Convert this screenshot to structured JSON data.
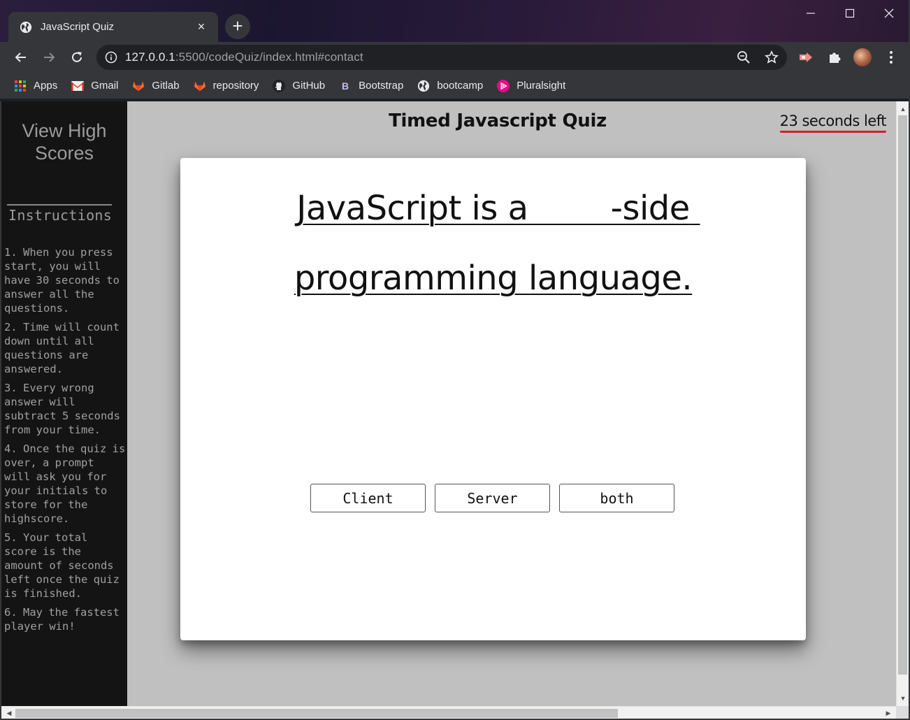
{
  "browser": {
    "tab_title": "JavaScript Quiz",
    "tab_close": "×",
    "new_tab": "+",
    "url_host": "127.0.0.1",
    "url_rest": ":5500/codeQuiz/index.html#contact",
    "bookmarks": [
      {
        "label": "Apps",
        "icon": "apps-grid-icon"
      },
      {
        "label": "Gmail",
        "icon": "gmail-icon"
      },
      {
        "label": "Gitlab",
        "icon": "gitlab-icon"
      },
      {
        "label": "repository",
        "icon": "gitlab-icon"
      },
      {
        "label": "GitHub",
        "icon": "github-icon"
      },
      {
        "label": "Bootstrap",
        "icon": "bootstrap-icon"
      },
      {
        "label": "bootcamp",
        "icon": "globe-icon"
      },
      {
        "label": "Pluralsight",
        "icon": "pluralsight-icon"
      }
    ]
  },
  "sidebar": {
    "title": "View High Scores",
    "heading": "Instructions",
    "instructions": [
      "1. When you press start, you will have 30 seconds to answer all the questions.",
      "2. Time will count down until all questions are answered.",
      "3. Every wrong answer will subtract 5 seconds from your time.",
      "4. Once the quiz is over, a prompt will ask you for your initials to store for the highscore.",
      "5. Your total score is the amount of seconds left once the quiz is finished.",
      "6. May the fastest player win!"
    ]
  },
  "main": {
    "title": "Timed Javascript Quiz",
    "timer": "23 seconds left",
    "question": "JavaScript is a        -side programming language.",
    "answers": [
      "Client",
      "Server",
      "both"
    ]
  },
  "colors": {
    "accent_underline": "#d0202a",
    "sidebar_bg": "#141414",
    "page_bg": "#c0c0c0"
  }
}
